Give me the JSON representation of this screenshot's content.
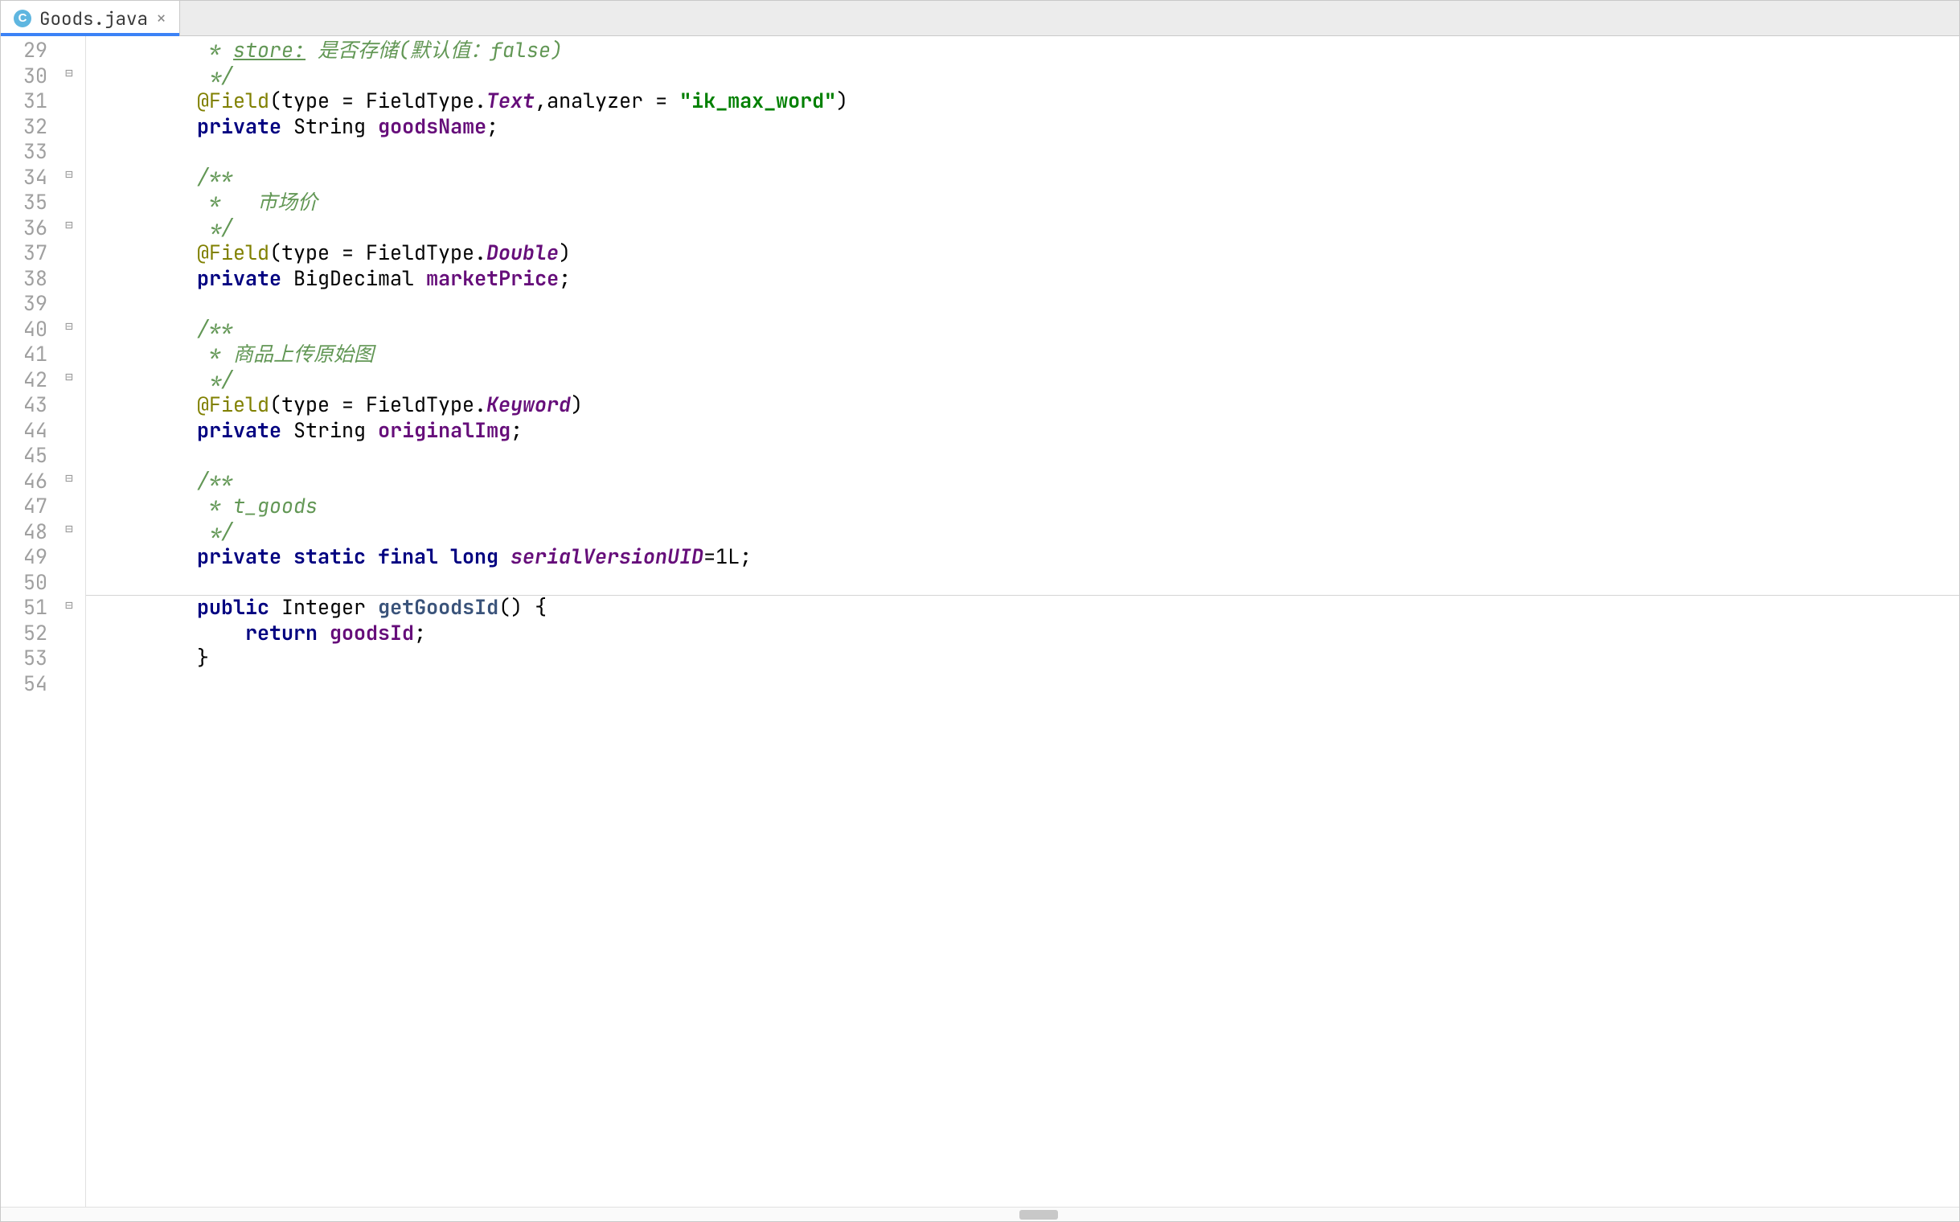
{
  "tab": {
    "icon_letter": "C",
    "label": "Goods.java",
    "close_glyph": "×"
  },
  "gutter": {
    "start": 29,
    "end": 54
  },
  "fold_markers": [
    {
      "line": 30,
      "glyph": "⊟"
    },
    {
      "line": 34,
      "glyph": "⊟"
    },
    {
      "line": 36,
      "glyph": "⊟"
    },
    {
      "line": 40,
      "glyph": "⊟"
    },
    {
      "line": 42,
      "glyph": "⊟"
    },
    {
      "line": 46,
      "glyph": "⊟"
    },
    {
      "line": 48,
      "glyph": "⊟"
    },
    {
      "line": 51,
      "glyph": "⊟"
    }
  ],
  "code": {
    "lines": [
      {
        "n": 29,
        "indent": "         ",
        "tokens": [
          {
            "cls": "c-doc",
            "t": "* "
          },
          {
            "cls": "c-doctag",
            "t": "store:"
          },
          {
            "cls": "c-doc",
            "t": " 是否存储(默认值：false)"
          }
        ]
      },
      {
        "n": 30,
        "indent": "         ",
        "tokens": [
          {
            "cls": "c-doc",
            "t": "*/"
          }
        ]
      },
      {
        "n": 31,
        "indent": "        ",
        "tokens": [
          {
            "cls": "c-ann",
            "t": "@Field"
          },
          {
            "cls": "c-paren",
            "t": "(type = FieldType."
          },
          {
            "cls": "c-enum",
            "t": "Text"
          },
          {
            "cls": "c-paren",
            "t": ",analyzer = "
          },
          {
            "cls": "c-str",
            "t": "\"ik_max_word\""
          },
          {
            "cls": "c-paren",
            "t": ")"
          }
        ]
      },
      {
        "n": 32,
        "indent": "        ",
        "tokens": [
          {
            "cls": "c-kw",
            "t": "private"
          },
          {
            "cls": "c-plain",
            "t": " "
          },
          {
            "cls": "c-type",
            "t": "String"
          },
          {
            "cls": "c-plain",
            "t": " "
          },
          {
            "cls": "c-field",
            "t": "goodsName"
          },
          {
            "cls": "c-plain",
            "t": ";"
          }
        ]
      },
      {
        "n": 33,
        "indent": "",
        "tokens": []
      },
      {
        "n": 34,
        "indent": "        ",
        "tokens": [
          {
            "cls": "c-doc",
            "t": "/**"
          }
        ]
      },
      {
        "n": 35,
        "indent": "         ",
        "tokens": [
          {
            "cls": "c-doc",
            "t": "*   市场价"
          }
        ]
      },
      {
        "n": 36,
        "indent": "         ",
        "tokens": [
          {
            "cls": "c-doc",
            "t": "*/"
          }
        ]
      },
      {
        "n": 37,
        "indent": "        ",
        "tokens": [
          {
            "cls": "c-ann",
            "t": "@Field"
          },
          {
            "cls": "c-paren",
            "t": "(type = FieldType."
          },
          {
            "cls": "c-enum",
            "t": "Double"
          },
          {
            "cls": "c-paren",
            "t": ")"
          }
        ]
      },
      {
        "n": 38,
        "indent": "        ",
        "tokens": [
          {
            "cls": "c-kw",
            "t": "private"
          },
          {
            "cls": "c-plain",
            "t": " "
          },
          {
            "cls": "c-type",
            "t": "BigDecimal"
          },
          {
            "cls": "c-plain",
            "t": " "
          },
          {
            "cls": "c-field",
            "t": "marketPrice"
          },
          {
            "cls": "c-plain",
            "t": ";"
          }
        ]
      },
      {
        "n": 39,
        "indent": "",
        "tokens": []
      },
      {
        "n": 40,
        "indent": "        ",
        "tokens": [
          {
            "cls": "c-doc",
            "t": "/**"
          }
        ]
      },
      {
        "n": 41,
        "indent": "         ",
        "tokens": [
          {
            "cls": "c-doc",
            "t": "* 商品上传原始图"
          }
        ]
      },
      {
        "n": 42,
        "indent": "         ",
        "tokens": [
          {
            "cls": "c-doc",
            "t": "*/"
          }
        ]
      },
      {
        "n": 43,
        "indent": "        ",
        "tokens": [
          {
            "cls": "c-ann",
            "t": "@Field"
          },
          {
            "cls": "c-paren",
            "t": "(type = FieldType."
          },
          {
            "cls": "c-enum",
            "t": "Keyword"
          },
          {
            "cls": "c-paren",
            "t": ")"
          }
        ]
      },
      {
        "n": 44,
        "indent": "        ",
        "tokens": [
          {
            "cls": "c-kw",
            "t": "private"
          },
          {
            "cls": "c-plain",
            "t": " "
          },
          {
            "cls": "c-type",
            "t": "String"
          },
          {
            "cls": "c-plain",
            "t": " "
          },
          {
            "cls": "c-field",
            "t": "originalImg"
          },
          {
            "cls": "c-plain",
            "t": ";"
          }
        ]
      },
      {
        "n": 45,
        "indent": "",
        "tokens": []
      },
      {
        "n": 46,
        "indent": "        ",
        "tokens": [
          {
            "cls": "c-doc",
            "t": "/**"
          }
        ]
      },
      {
        "n": 47,
        "indent": "         ",
        "tokens": [
          {
            "cls": "c-doc",
            "t": "* t_goods"
          }
        ]
      },
      {
        "n": 48,
        "indent": "         ",
        "tokens": [
          {
            "cls": "c-doc",
            "t": "*/"
          }
        ]
      },
      {
        "n": 49,
        "indent": "        ",
        "tokens": [
          {
            "cls": "c-kw",
            "t": "private static final long"
          },
          {
            "cls": "c-plain",
            "t": " "
          },
          {
            "cls": "c-serial",
            "t": "serialVersionUID"
          },
          {
            "cls": "c-plain",
            "t": "=1L;"
          }
        ]
      },
      {
        "n": 50,
        "indent": "",
        "tokens": []
      },
      {
        "n": 51,
        "indent": "        ",
        "tokens": [
          {
            "cls": "c-kw",
            "t": "public"
          },
          {
            "cls": "c-plain",
            "t": " "
          },
          {
            "cls": "c-type",
            "t": "Integer"
          },
          {
            "cls": "c-plain",
            "t": " "
          },
          {
            "cls": "c-declmeth",
            "t": "getGoodsId"
          },
          {
            "cls": "c-plain",
            "t": "() {"
          }
        ]
      },
      {
        "n": 52,
        "indent": "            ",
        "tokens": [
          {
            "cls": "c-kw",
            "t": "return"
          },
          {
            "cls": "c-plain",
            "t": " "
          },
          {
            "cls": "c-field",
            "t": "goodsId"
          },
          {
            "cls": "c-plain",
            "t": ";"
          }
        ]
      },
      {
        "n": 53,
        "indent": "        ",
        "tokens": [
          {
            "cls": "c-plain",
            "t": "}"
          }
        ]
      },
      {
        "n": 54,
        "indent": "",
        "tokens": []
      }
    ]
  },
  "method_separator_before_line": 51,
  "scrollbar": {
    "thumb_left_pct": 52,
    "thumb_width_pct": 2
  }
}
